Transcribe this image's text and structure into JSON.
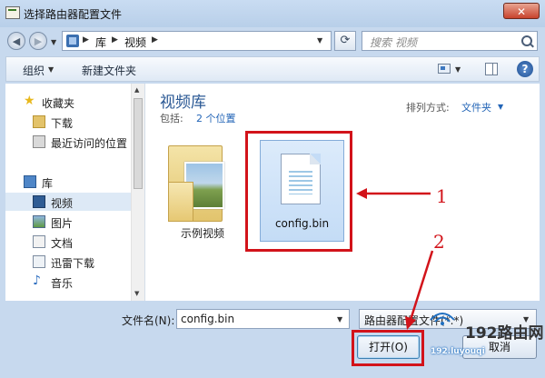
{
  "window": {
    "title": "选择路由器配置文件",
    "close_label": "✕"
  },
  "address": {
    "crumbs": [
      "库",
      "视频"
    ],
    "search_placeholder": "搜索 视频"
  },
  "toolbar": {
    "organize": "组织",
    "new_folder": "新建文件夹",
    "help": "?"
  },
  "nav": {
    "favorites_label": "收藏夹",
    "favorites": [
      "下载",
      "最近访问的位置"
    ],
    "libraries_label": "库",
    "libraries": [
      "视频",
      "图片",
      "文档",
      "迅雷下载",
      "音乐"
    ],
    "selected": "视频"
  },
  "library": {
    "title": "视频库",
    "includes_label": "包括:",
    "includes_link": "2 个位置",
    "arrange_label": "排列方式:",
    "arrange_value": "文件夹"
  },
  "files": [
    {
      "name": "示例视频",
      "type": "folder"
    },
    {
      "name": "config.bin",
      "type": "file",
      "selected": true
    }
  ],
  "annotations": [
    "1",
    "2"
  ],
  "bottom": {
    "filename_label": "文件名(N):",
    "filename_value": "config.bin",
    "filetype_value": "路由器配置文件(*.*)",
    "open_button": "打开(O)",
    "cancel_button": "取消"
  },
  "watermark": {
    "brand": "192路由网",
    "url": "192.luyouqi"
  },
  "colors": {
    "accent_red": "#d2131a",
    "link_blue": "#2365b7",
    "title_blue": "#2a5894"
  }
}
